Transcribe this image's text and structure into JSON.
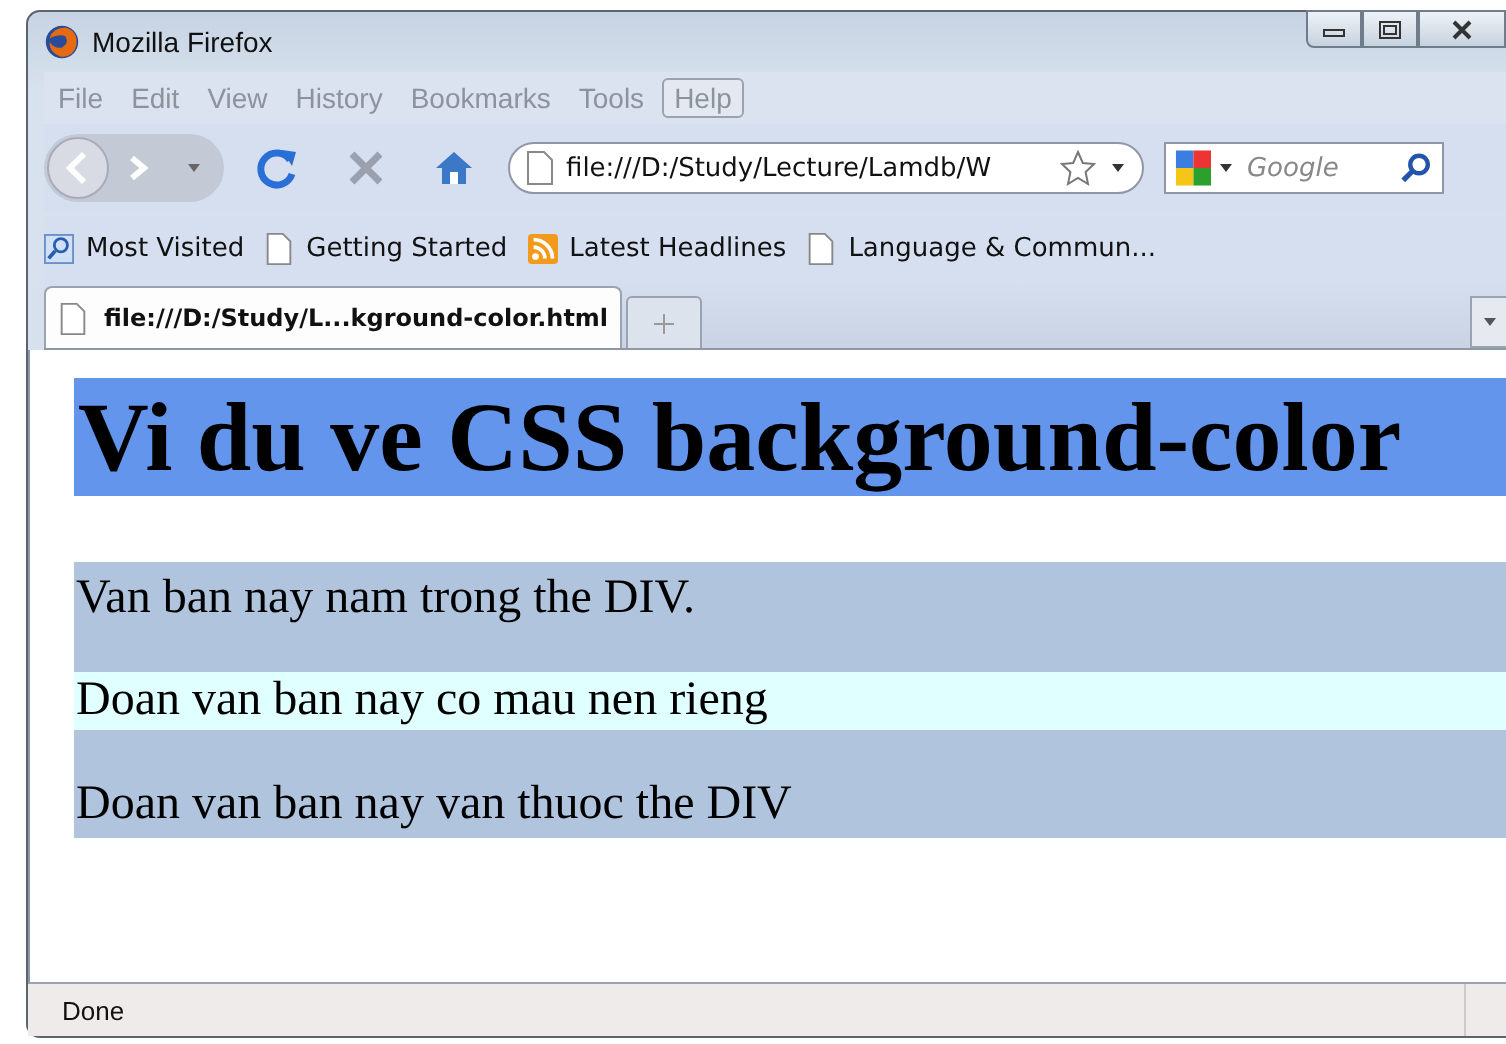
{
  "window": {
    "title": "Mozilla Firefox"
  },
  "menu": [
    {
      "label": "File",
      "disabled": true
    },
    {
      "label": "Edit",
      "disabled": true
    },
    {
      "label": "View",
      "disabled": true
    },
    {
      "label": "History",
      "disabled": true
    },
    {
      "label": "Bookmarks",
      "disabled": true
    },
    {
      "label": "Tools",
      "disabled": true
    },
    {
      "label": "Help",
      "disabled": true
    }
  ],
  "address": {
    "value": "file:///D:/Study/Lecture/Lamdb/W"
  },
  "search": {
    "placeholder": "Google"
  },
  "bookmarks": [
    {
      "label": "Most Visited",
      "kind": "search"
    },
    {
      "label": "Getting Started",
      "kind": "page"
    },
    {
      "label": "Latest Headlines",
      "kind": "feed"
    },
    {
      "label": "Language & Commun...",
      "kind": "page"
    }
  ],
  "tabs": [
    {
      "label": "file:///D:/Study/L...kground-color.html",
      "selected": true
    }
  ],
  "page": {
    "heading": "Vi du ve CSS background-color",
    "div_text": "Van ban nay nam trong the DIV.",
    "inner_paragraph": "Doan van ban nay co mau nen rieng",
    "div_text_after": "Doan van ban nay van thuoc the DIV"
  },
  "status_bar": "Done"
}
